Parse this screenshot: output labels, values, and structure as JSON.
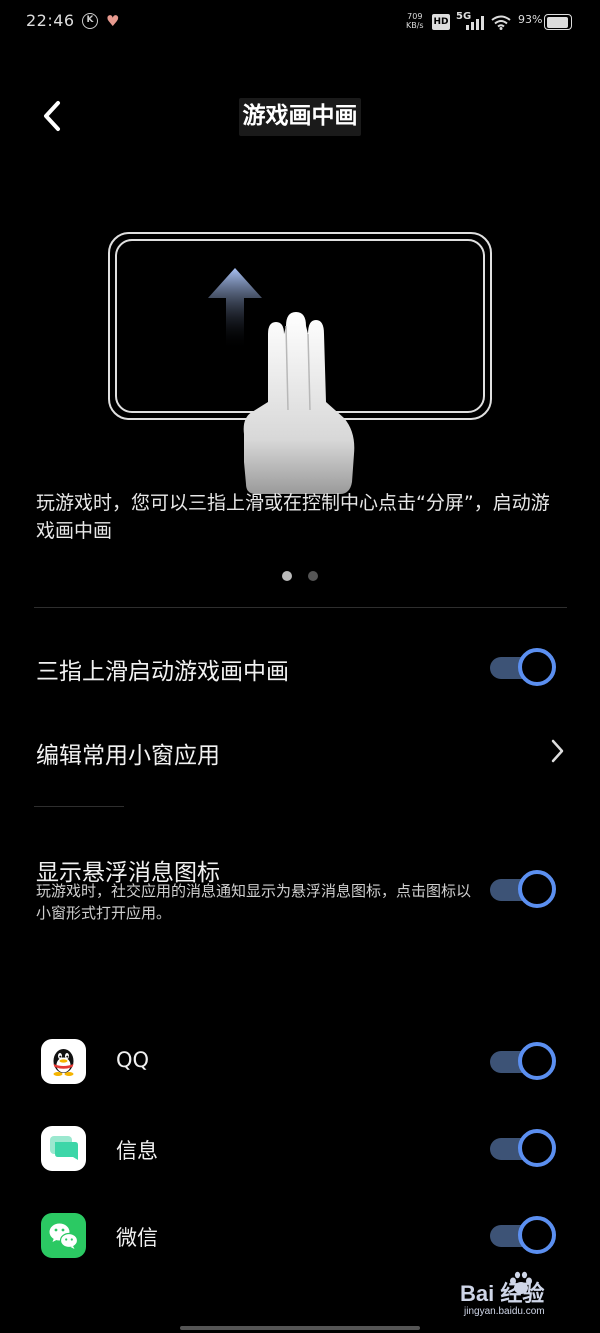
{
  "status_bar": {
    "time": "22:46",
    "k_badge": "K",
    "net_speed_value": "709",
    "net_speed_unit": "KB/s",
    "hd_label": "HD",
    "network_label": "5G",
    "battery_percent": "93%",
    "battery_level": 0.93
  },
  "header": {
    "title": "游戏画中画"
  },
  "intro": {
    "description": "玩游戏时，您可以三指上滑或在控制中心点击“分屏”，启动游戏画中画",
    "pager_total": 2,
    "pager_active": 1
  },
  "settings": {
    "three_finger_label": "三指上滑启动游戏画中画",
    "three_finger_on": true,
    "edit_apps_label": "编辑常用小窗应用",
    "floating_icon_label": "显示悬浮消息图标",
    "floating_icon_desc": "玩游戏时，社交应用的消息通知显示为悬浮消息图标，点击图标以小窗形式打开应用。",
    "floating_icon_on": true
  },
  "apps": [
    {
      "name": "QQ",
      "icon": "qq-icon",
      "enabled": true
    },
    {
      "name": "信息",
      "icon": "messages-icon",
      "enabled": true
    },
    {
      "name": "微信",
      "icon": "wechat-icon",
      "enabled": true
    }
  ],
  "colors": {
    "toggle_accent": "#5b8ff0",
    "toggle_track": "#3d5376",
    "wechat_green": "#2bc963",
    "messages_green": "#3dd6a8"
  },
  "watermark": {
    "logo": "Bai  经验",
    "site": "jingyan.baidu.com"
  }
}
